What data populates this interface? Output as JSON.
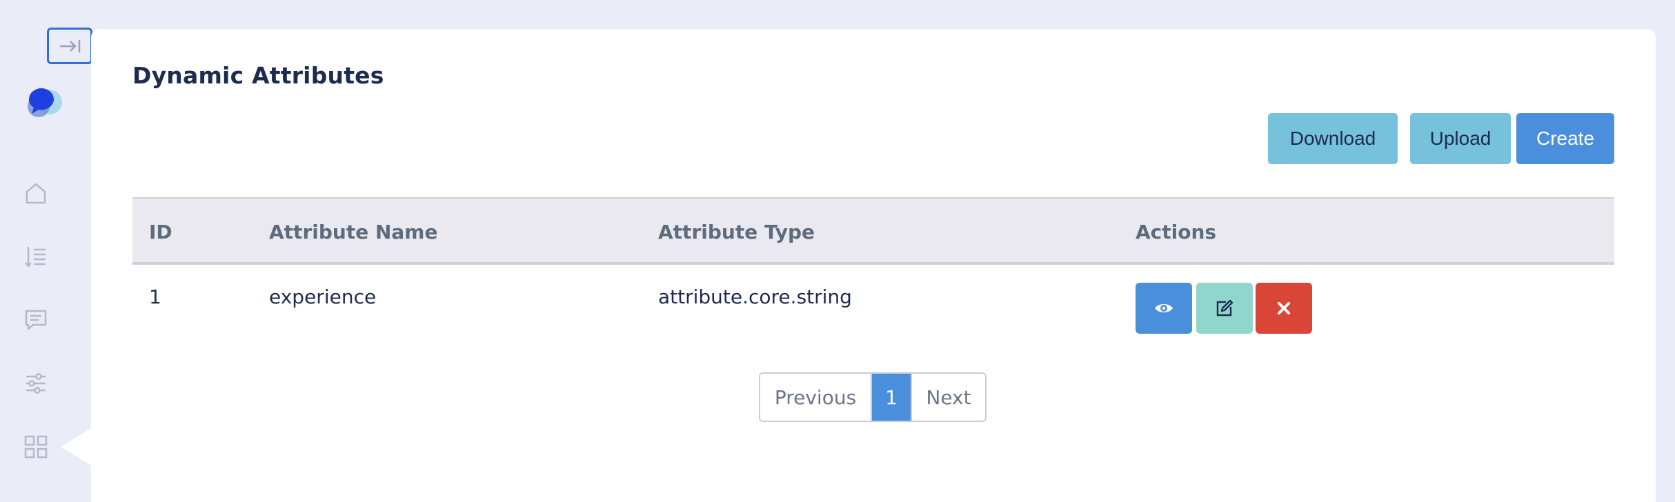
{
  "page": {
    "title": "Dynamic Attributes"
  },
  "toolbar": {
    "download_label": "Download",
    "upload_label": "Upload",
    "create_label": "Create"
  },
  "sidebar": {
    "items": [
      {
        "icon": "home-icon"
      },
      {
        "icon": "sort-list-icon"
      },
      {
        "icon": "chat-icon"
      },
      {
        "icon": "sliders-icon"
      },
      {
        "icon": "grid-icon",
        "active": true
      }
    ]
  },
  "table": {
    "headers": [
      "ID",
      "Attribute Name",
      "Attribute Type",
      "Actions"
    ],
    "rows": [
      {
        "id": "1",
        "name": "experience",
        "type": "attribute.core.string"
      }
    ]
  },
  "pagination": {
    "previous_label": "Previous",
    "current_page": "1",
    "next_label": "Next"
  },
  "colors": {
    "accent": "#4a8fdb",
    "info": "#76c1dc",
    "edit": "#91d6cc",
    "danger": "#d94637",
    "title": "#1d2b4f"
  }
}
